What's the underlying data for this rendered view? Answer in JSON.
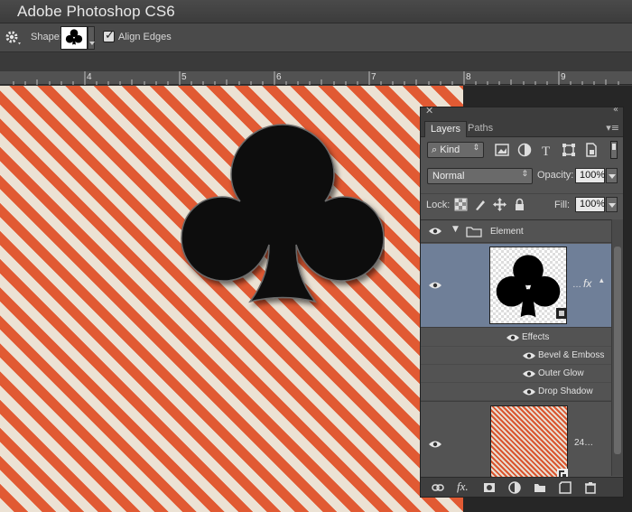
{
  "app": {
    "title": "Adobe Photoshop CS6"
  },
  "options_bar": {
    "shape_label": "Shape:",
    "align_edges_label": "Align Edges",
    "align_edges_checked": true
  },
  "ruler": {
    "labels": [
      "4",
      "5",
      "6",
      "7",
      "8",
      "9"
    ]
  },
  "layers_panel": {
    "tabs": [
      "Layers",
      "Paths"
    ],
    "active_tab": "Layers",
    "filter_kind": "Kind",
    "blend_mode": "Normal",
    "opacity_label": "Opacity:",
    "opacity_value": "100%",
    "lock_label": "Lock:",
    "fill_label": "Fill:",
    "fill_value": "100%",
    "layers": [
      {
        "name": "Element",
        "type": "group",
        "expanded": true
      },
      {
        "name": "…",
        "fx": "fx",
        "selected": true
      },
      {
        "name": "24…",
        "type": "background-image"
      }
    ],
    "effects_title": "Effects",
    "effects": [
      "Bevel & Emboss",
      "Outer Glow",
      "Drop Shadow"
    ]
  },
  "colors": {
    "stripe_orange": "#e15a33",
    "stripe_cream": "#ece2d4",
    "selection": "#6f7f98"
  }
}
